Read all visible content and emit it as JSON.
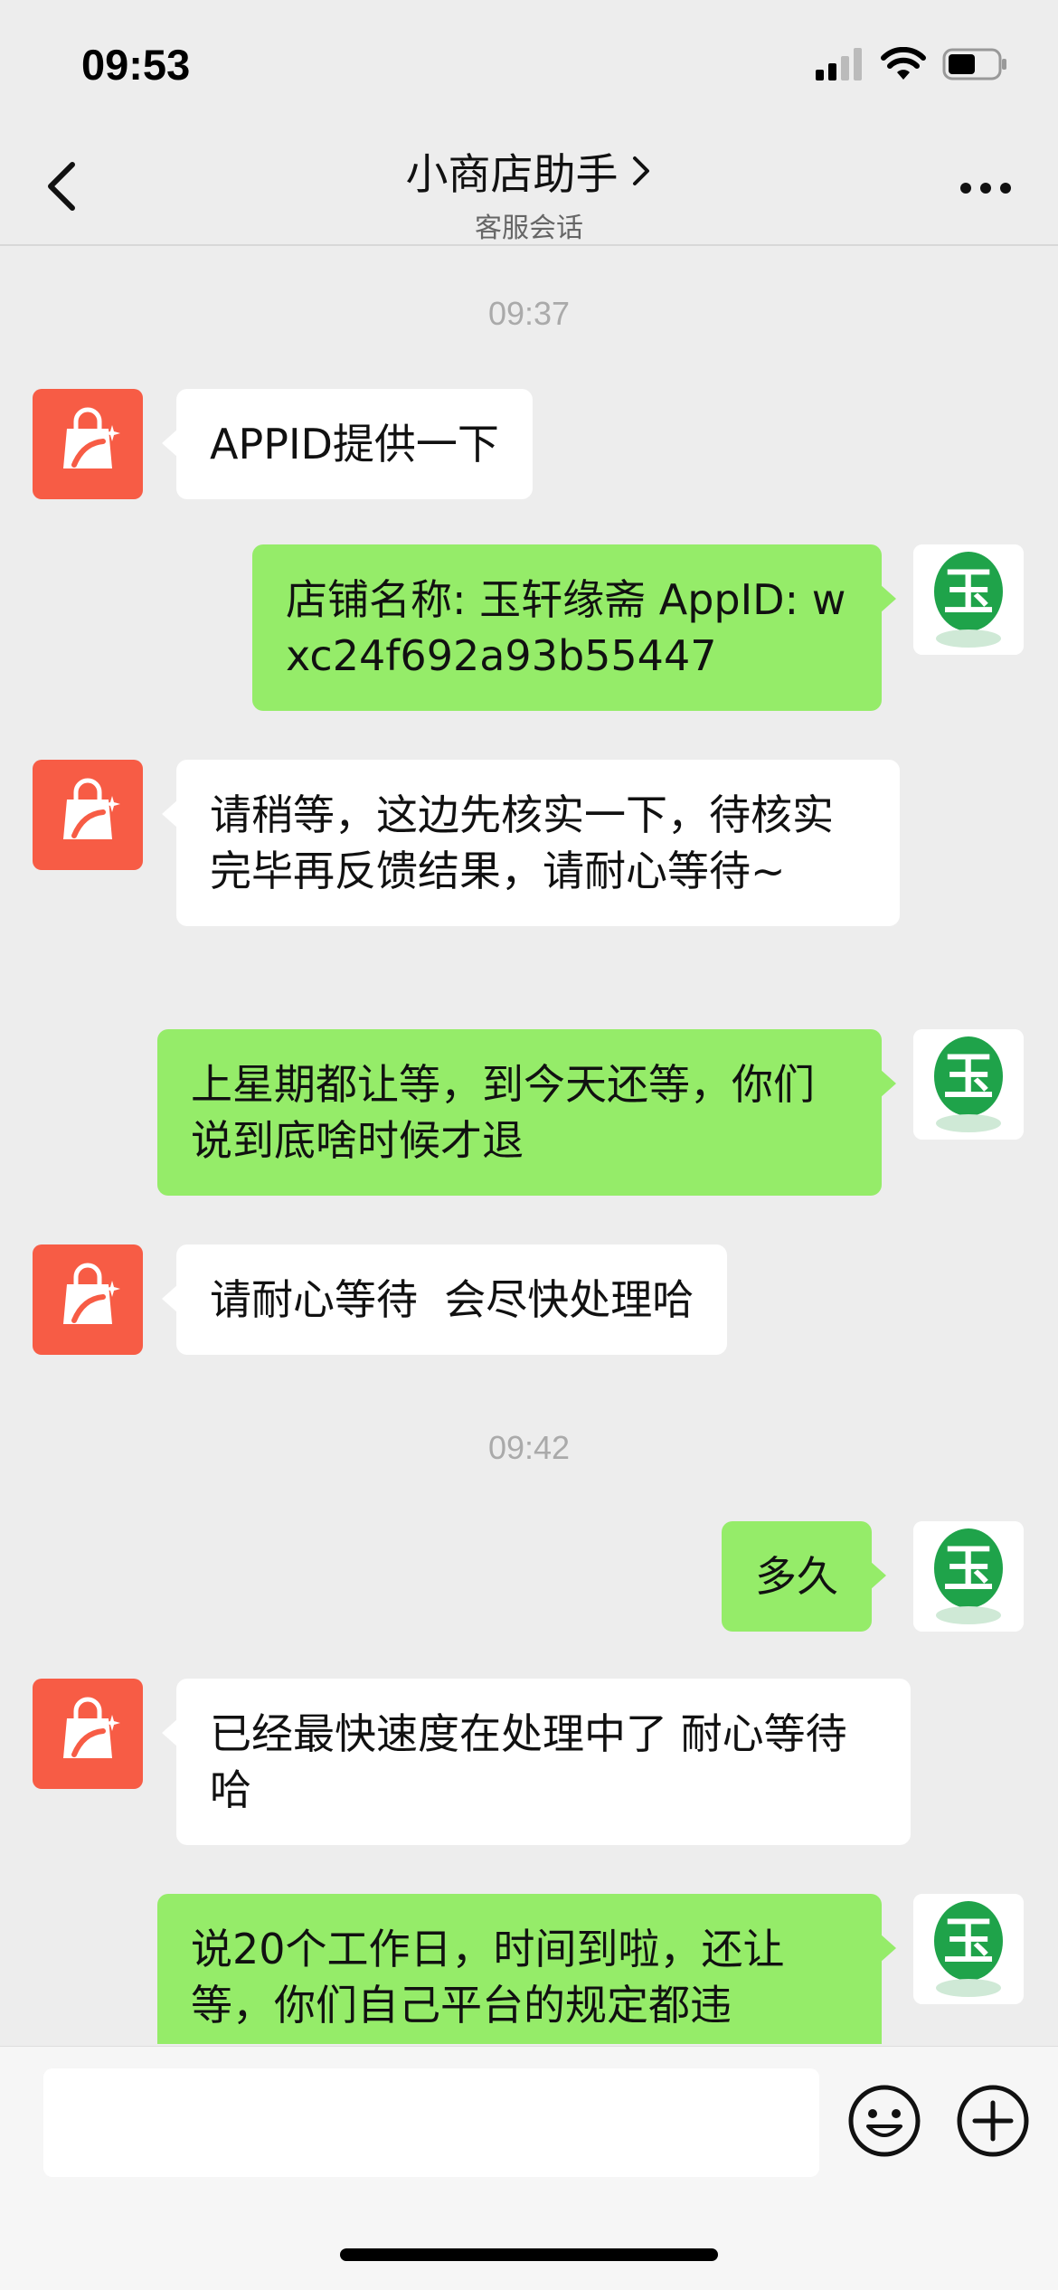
{
  "status_bar": {
    "time": "09:53",
    "battery_level": 0.55
  },
  "nav": {
    "title": "小商店助手",
    "subtitle": "客服会话"
  },
  "messages": [
    {
      "type": "time",
      "text": "09:37"
    },
    {
      "type": "in",
      "text": "APPID提供一下"
    },
    {
      "type": "out",
      "text": "店铺名称: 玉轩缘斋 AppID: wxc24f692a93b55447"
    },
    {
      "type": "in",
      "text": "请稍等，这边先核实一下，待核实完毕再反馈结果，请耐心等待~"
    },
    {
      "type": "out",
      "text": "上星期都让等，到今天还等，你们说到底啥时候才退"
    },
    {
      "type": "in",
      "text": "请耐心等待  会尽快处理哈"
    },
    {
      "type": "time",
      "text": "09:42"
    },
    {
      "type": "out",
      "text": "多久"
    },
    {
      "type": "in",
      "text": "已经最快速度在处理中了 耐心等待哈"
    },
    {
      "type": "out",
      "text": "说20个工作日，时间到啦，还让等，你们自己平台的规定都违"
    }
  ],
  "colors": {
    "out_bubble": "#95ec69",
    "in_bubble": "#ffffff",
    "bot_avatar": "#f75c45",
    "background": "#ededed"
  },
  "icons": {
    "back": "chevron-left-icon",
    "title_arrow": "chevron-right-icon",
    "more": "more-dots-icon",
    "emoji": "emoji-icon",
    "plus": "plus-circle-icon"
  },
  "input": {
    "value": ""
  }
}
